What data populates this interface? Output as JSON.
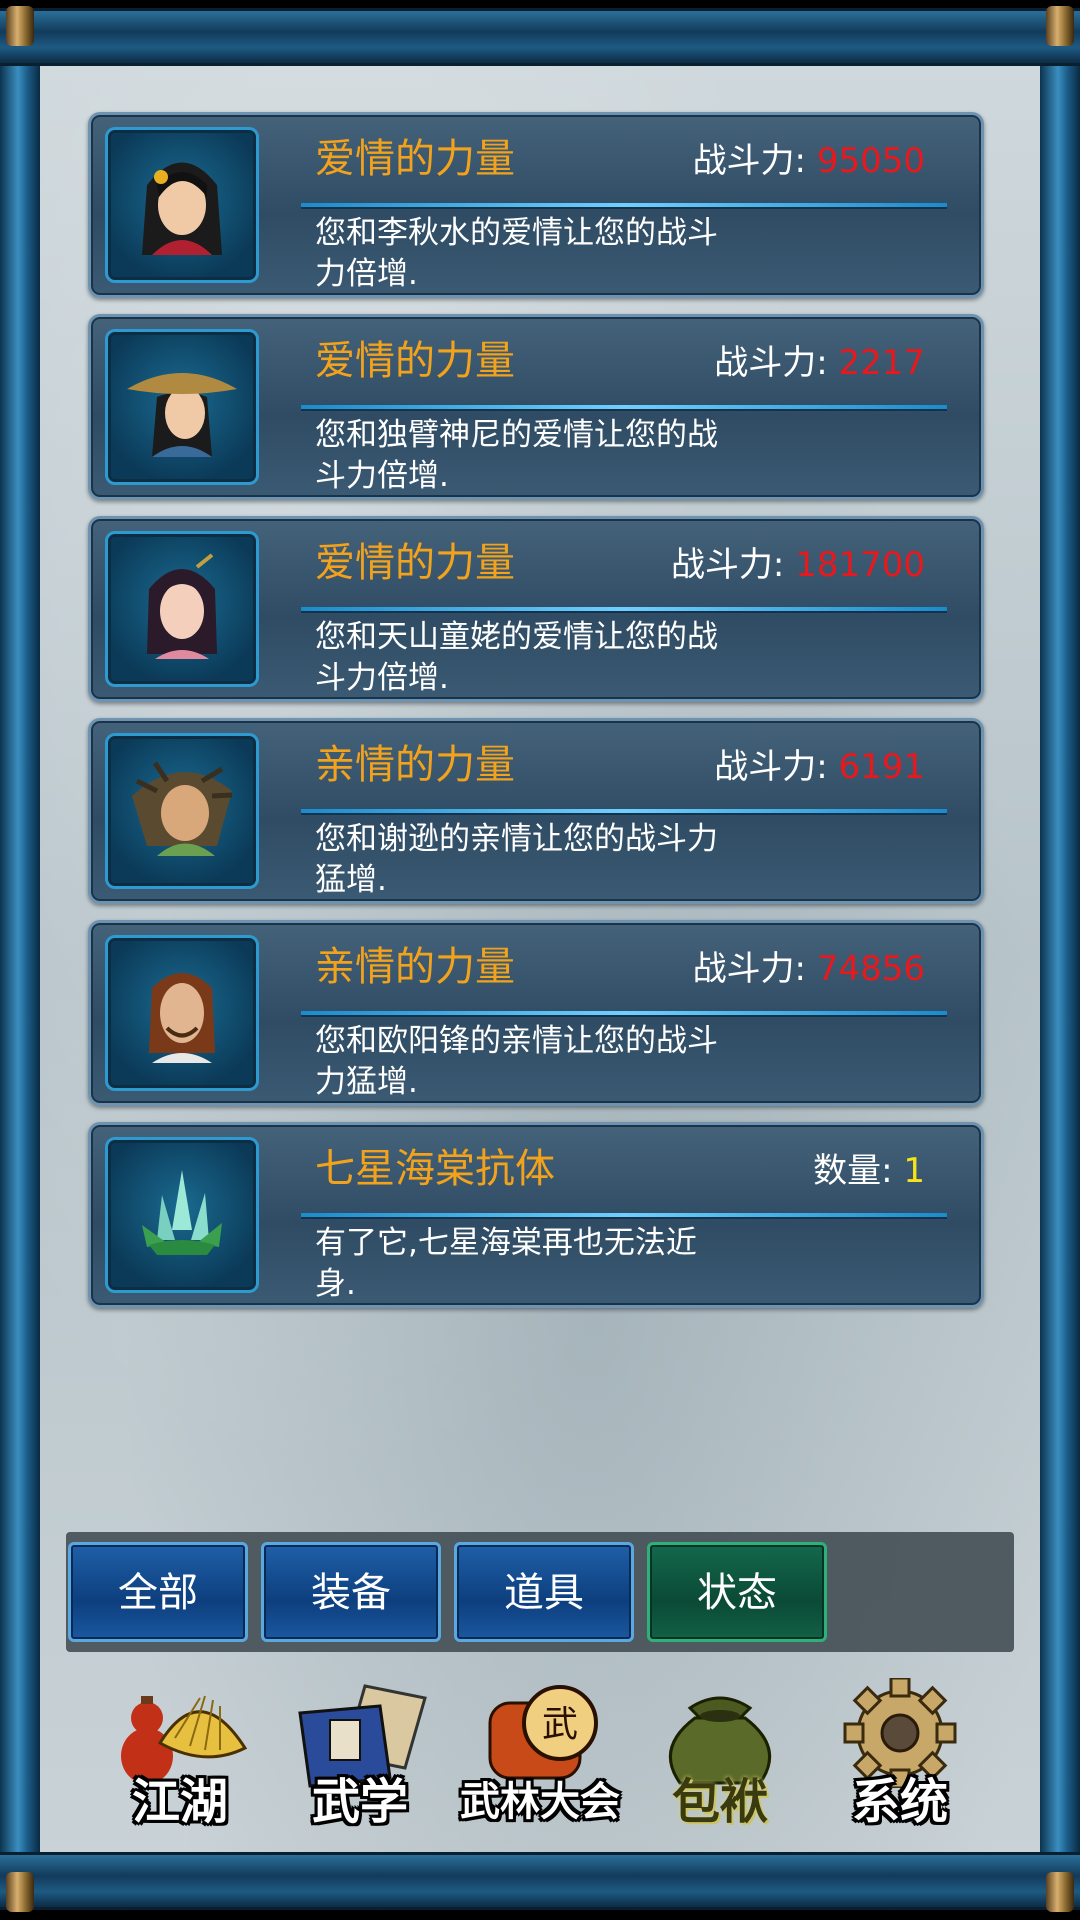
{
  "cards": [
    {
      "icon": "woman-portrait-icon",
      "title": "爱情的力量",
      "stat_label": "战斗力: ",
      "stat_value": "95050",
      "value_color": "#e8181c",
      "desc": "您和李秋水的爱情让您的战斗力倍增."
    },
    {
      "icon": "straw-hat-woman-portrait-icon",
      "title": "爱情的力量",
      "stat_label": "战斗力: ",
      "stat_value": "2217",
      "value_color": "#e8181c",
      "desc": "您和独臂神尼的爱情让您的战斗力倍增."
    },
    {
      "icon": "girl-portrait-icon",
      "title": "爱情的力量",
      "stat_label": "战斗力: ",
      "stat_value": "181700",
      "value_color": "#e8181c",
      "desc": "您和天山童姥的爱情让您的战斗力倍增."
    },
    {
      "icon": "wild-haired-man-portrait-icon",
      "title": "亲情的力量",
      "stat_label": "战斗力: ",
      "stat_value": "6191",
      "value_color": "#e8181c",
      "desc": "您和谢逊的亲情让您的战斗力猛增."
    },
    {
      "icon": "man-portrait-icon",
      "title": "亲情的力量",
      "stat_label": "战斗力: ",
      "stat_value": "74856",
      "value_color": "#e8181c",
      "desc": "您和欧阳锋的亲情让您的战斗力猛增."
    },
    {
      "icon": "green-crystal-icon",
      "title": "七星海棠抗体",
      "stat_label": "数量: ",
      "stat_value": "1",
      "value_color": "#f6e418",
      "desc": "有了它,七星海棠再也无法近身."
    }
  ],
  "tabs": [
    {
      "label": "全部",
      "active": false
    },
    {
      "label": "装备",
      "active": false
    },
    {
      "label": "道具",
      "active": false
    },
    {
      "label": "状态",
      "active": true
    }
  ],
  "nav": [
    {
      "icon": "gourd-straw-hat-icon",
      "label": "江湖"
    },
    {
      "icon": "martial-book-icon",
      "label": "武学"
    },
    {
      "icon": "war-drum-icon",
      "label": "武林大会"
    },
    {
      "icon": "cloth-bag-icon",
      "label": "包袱",
      "active": true
    },
    {
      "icon": "gear-icon",
      "label": "系统"
    }
  ]
}
